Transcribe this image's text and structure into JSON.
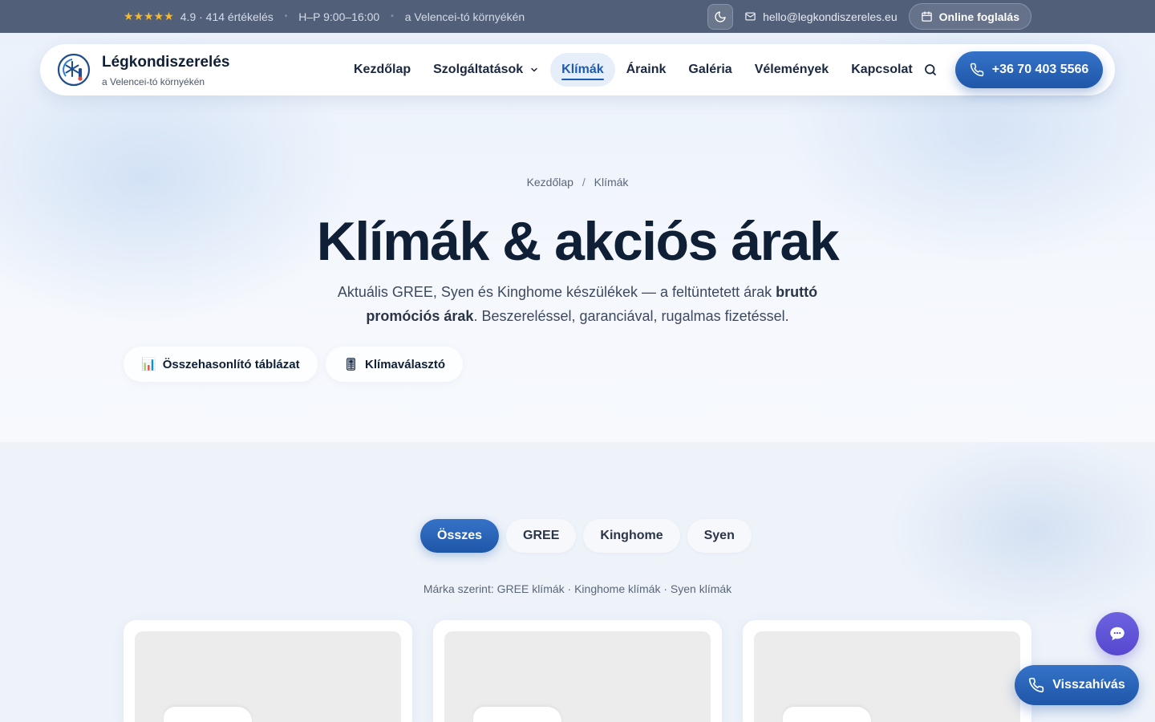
{
  "topbar": {
    "rating_stars": "★★★★★",
    "rating_text": "4.9 · 414 értékelés",
    "hours": "H–P 9:00–16:00",
    "area": "a Velencei-tó környékén",
    "email": "hello@legkondiszereles.eu",
    "booking_label": "Online foglalás",
    "star_color": "#f7b82a"
  },
  "brand": {
    "name": "Légkondiszerelés",
    "subtitle": "a Velencei-tó környékén"
  },
  "nav": {
    "items": [
      {
        "label": "Kezdőlap"
      },
      {
        "label": "Szolgáltatások"
      },
      {
        "label": "Klímák",
        "active": true
      },
      {
        "label": "Áraink"
      },
      {
        "label": "Galéria"
      },
      {
        "label": "Vélemények"
      },
      {
        "label": "Kapcsolat"
      }
    ],
    "phone": "+36 70 403 5566",
    "accent": "#1f56a8"
  },
  "hero": {
    "breadcrumb": [
      "Kezdőlap",
      "Klímák"
    ],
    "breadcrumb_sep": "/",
    "title": "Klímák & akciós árak",
    "desc_pre": "Aktuális GREE, Syen és Kinghome készülékek — a feltüntetett árak ",
    "desc_bold": "bruttó promóciós árak",
    "desc_post": ". Beszereléssel, garanciával, rugalmas fizetéssel.",
    "links": [
      {
        "icon": "📊",
        "label": "Összehasonlító táblázat"
      },
      {
        "icon": "🎚",
        "label": "Klímaválasztó"
      }
    ]
  },
  "filters": {
    "tabs": [
      {
        "label": "Összes",
        "active": true
      },
      {
        "label": "GREE"
      },
      {
        "label": "Kinghome"
      },
      {
        "label": "Syen"
      }
    ],
    "brand_links": "Márka szerint: GREE klímák · Kinghome klímák · Syen klímák"
  },
  "floating": {
    "callback_label": "Visszahívás",
    "chat_color": "#5648cf"
  }
}
